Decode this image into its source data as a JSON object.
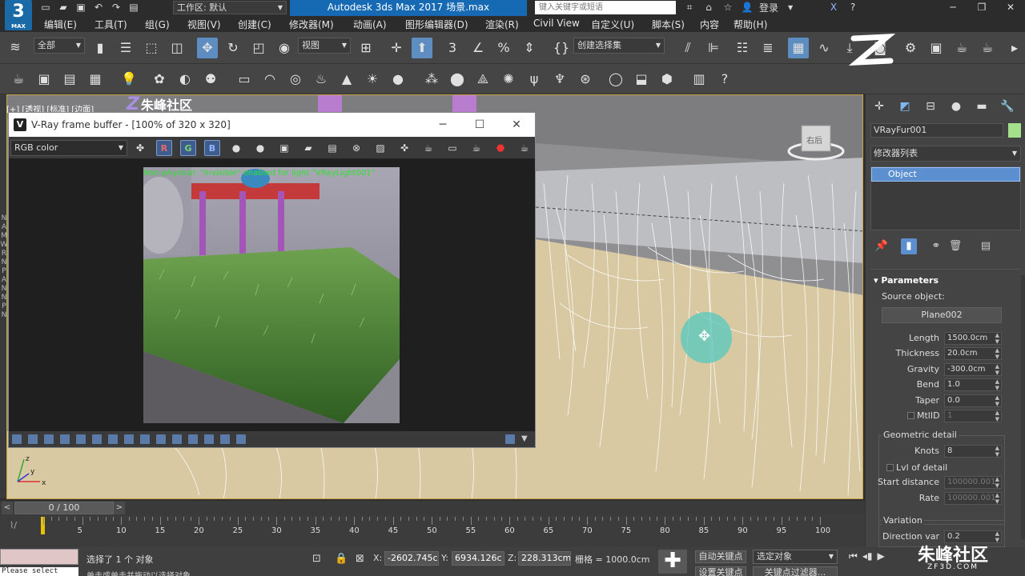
{
  "app": {
    "logo_text": "3",
    "logo_sub": "MAX",
    "workspace_label": "工作区: 默认",
    "window_title": "Autodesk 3ds Max 2017     场景.max",
    "search_placeholder": "键入关键字或短语",
    "login_label": "登录",
    "accent_color": "#1669b3"
  },
  "menu": {
    "items": [
      "编辑(E)",
      "工具(T)",
      "组(G)",
      "视图(V)",
      "创建(C)",
      "修改器(M)",
      "动画(A)",
      "图形编辑器(D)",
      "渲染(R)",
      "Civil View",
      "自定义(U)",
      "脚本(S)",
      "内容",
      "帮助(H)"
    ]
  },
  "toolbar": {
    "filter_dropdown": "全部",
    "view_dropdown": "视图",
    "selection_set_dropdown": "创建选择集",
    "snap_label": "3"
  },
  "viewport": {
    "label": "[+] [透视] [标准] [边面]",
    "cube_label": "右后"
  },
  "vfb": {
    "title": "V-Ray frame buffer - [100% of 320 x 320]",
    "channel": "RGB color",
    "r_label": "R",
    "g_label": "G",
    "b_label": "B",
    "render_note": "Non-physical: \"Invisible\" enabled for light \"VRayLight001\""
  },
  "command_panel": {
    "object_name": "VRayFur001",
    "object_color": "#a6df8c",
    "modifier_list": "修改器列表",
    "stack_item": "Object",
    "rollout_title": "Parameters",
    "source_object_label": "Source object:",
    "source_object_value": "Plane002",
    "params": [
      {
        "label": "Length",
        "value": "1500.0cm"
      },
      {
        "label": "Thickness",
        "value": "20.0cm"
      },
      {
        "label": "Gravity",
        "value": "-300.0cm"
      },
      {
        "label": "Bend",
        "value": "1.0"
      },
      {
        "label": "Taper",
        "value": "0.0"
      },
      {
        "label": "MtlID",
        "value": "1"
      }
    ],
    "geo_group_title": "Geometric detail",
    "knots_label": "Knots",
    "knots_value": "8",
    "lvl_label": "Lvl of detail",
    "start_distance_label": "Start distance",
    "start_distance_value": "100000.001",
    "rate_label": "Rate",
    "rate_value": "100000.001",
    "variation_title": "Variation",
    "direction_var_label": "Direction var",
    "direction_var_value": "0.2"
  },
  "timeline": {
    "frame_counter": "0 / 100",
    "ticks": [
      "5",
      "10",
      "15",
      "20",
      "25",
      "30",
      "35",
      "40",
      "45",
      "50",
      "55",
      "60",
      "65",
      "70",
      "75",
      "80",
      "85",
      "90",
      "95",
      "100"
    ]
  },
  "status": {
    "message": "选择了 1 个 对象",
    "message2": "单击或单击并拖动以选择对象",
    "maxscript_text": "Please select",
    "x_label": "X:",
    "x_value": "-2602.745c",
    "y_label": "Y:",
    "y_value": "6934.126c",
    "z_label": "Z:",
    "z_value": "228.313cm",
    "grid": "栅格 = 1000.0cm",
    "auto_key": "自动关键点",
    "set_key": "设置关键点",
    "selected_dropdown": "选定对象",
    "key_filter": "关键点过滤器..."
  },
  "watermark": {
    "top_text": "朱峰社区",
    "br_text": "朱峰社区",
    "br_sub": "ZF3D.COM"
  }
}
